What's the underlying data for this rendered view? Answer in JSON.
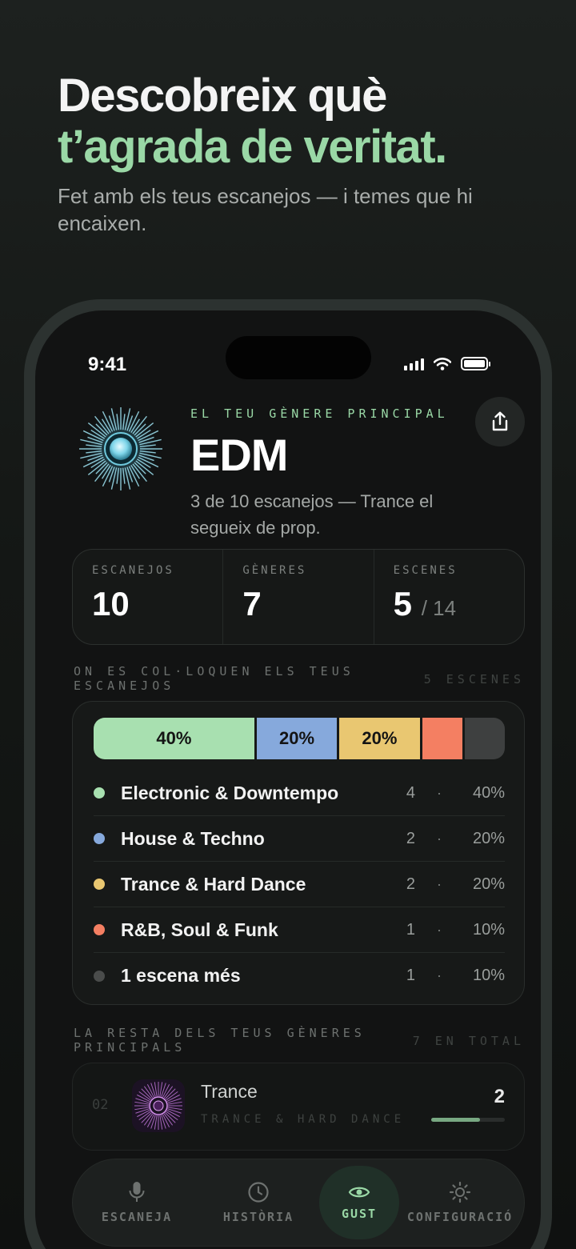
{
  "hero": {
    "title_line1": "Descobreix què",
    "title_line2": "t’agrada de veritat.",
    "subtitle": "Fet amb els teus escanejos — i temes que hi encaixen."
  },
  "status_bar": {
    "time": "9:41"
  },
  "top_genre": {
    "kicker": "EL TEU GÈNERE PRINCIPAL",
    "name": "EDM",
    "description": "3 de 10 escanejos — Trance el segueix de prop."
  },
  "stats": [
    {
      "label": "ESCANEJOS",
      "value": "10",
      "suffix": ""
    },
    {
      "label": "GÈNERES",
      "value": "7",
      "suffix": ""
    },
    {
      "label": "ESCENES",
      "value": "5",
      "suffix": "/ 14"
    }
  ],
  "distribution": {
    "heading": "ON ES COL·LOQUEN ELS TEUS ESCANEJOS",
    "count_label": "5 ESCENES",
    "segments": [
      {
        "label": "40%",
        "share": 40,
        "color": "#a8e0b0"
      },
      {
        "label": "20%",
        "share": 20,
        "color": "#86a9dc"
      },
      {
        "label": "20%",
        "share": 20,
        "color": "#e9c771"
      },
      {
        "label": "",
        "share": 10,
        "color": "#f47f62"
      },
      {
        "label": "",
        "share": 10,
        "color": "#3e4040"
      }
    ],
    "rows": [
      {
        "name": "Electronic & Downtempo",
        "count": "4",
        "sep": "·",
        "pct": "40%",
        "color": "#a8e0b0"
      },
      {
        "name": "House & Techno",
        "count": "2",
        "sep": "·",
        "pct": "20%",
        "color": "#86a9dc"
      },
      {
        "name": "Trance & Hard Dance",
        "count": "2",
        "sep": "·",
        "pct": "20%",
        "color": "#e9c771"
      },
      {
        "name": "R&B, Soul & Funk",
        "count": "1",
        "sep": "·",
        "pct": "10%",
        "color": "#f47f62"
      },
      {
        "name": "1 escena més",
        "count": "1",
        "sep": "·",
        "pct": "10%",
        "color": "#4a4c4b"
      }
    ]
  },
  "rest": {
    "heading": "LA RESTA DELS TEUS GÈNERES PRINCIPALS",
    "count_label": "7 EN TOTAL",
    "items": [
      {
        "rank": "02",
        "name": "Trance",
        "scene": "TRANCE & HARD DANCE",
        "count": "2",
        "level": 0.66
      }
    ]
  },
  "tabbar": {
    "tabs": [
      {
        "label": "ESCANEJA",
        "icon": "microphone-icon"
      },
      {
        "label": "HISTÒRIA",
        "icon": "clock-icon"
      },
      {
        "label": "GUST",
        "icon": "eye-icon",
        "active": true
      },
      {
        "label": "CONFIGURACIÓ",
        "icon": "gear-icon"
      }
    ]
  },
  "colors": {
    "accent": "#9ad8a6",
    "background": "#121313"
  }
}
